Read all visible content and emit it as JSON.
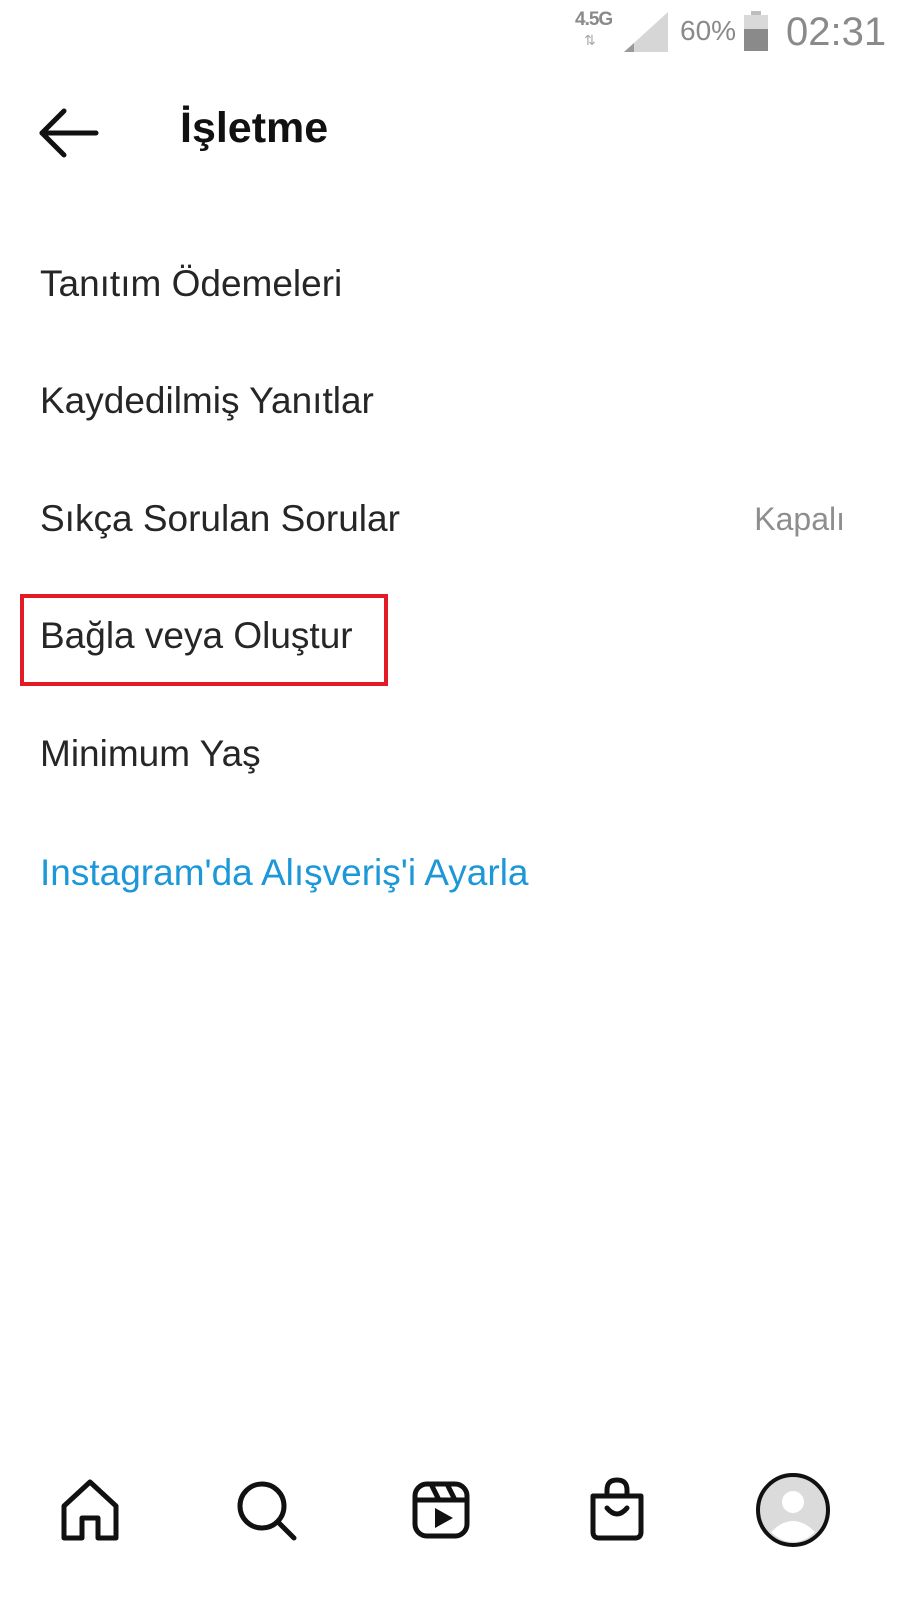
{
  "status_bar": {
    "network": "4.5G",
    "network_arrows": "⇅",
    "battery_percent": "60%",
    "time": "02:31"
  },
  "header": {
    "title": "İşletme"
  },
  "menu": {
    "items": [
      {
        "label": "Tanıtım Ödemeleri"
      },
      {
        "label": "Kaydedilmiş Yanıtlar"
      },
      {
        "label": "Sıkça Sorulan Sorular",
        "value": "Kapalı"
      },
      {
        "label": "Bağla veya Oluştur",
        "highlighted": true
      },
      {
        "label": "Minimum Yaş"
      }
    ],
    "link": {
      "label": "Instagram'da Alışveriş'i Ayarla"
    }
  },
  "colors": {
    "link": "#1c97d8",
    "highlight": "#e31b24",
    "text": "#262626",
    "muted": "#8e8e8e"
  },
  "icons": {
    "back": "arrow-left-icon",
    "nav": [
      "home-icon",
      "search-icon",
      "reels-icon",
      "shop-icon",
      "profile-avatar-icon"
    ]
  }
}
